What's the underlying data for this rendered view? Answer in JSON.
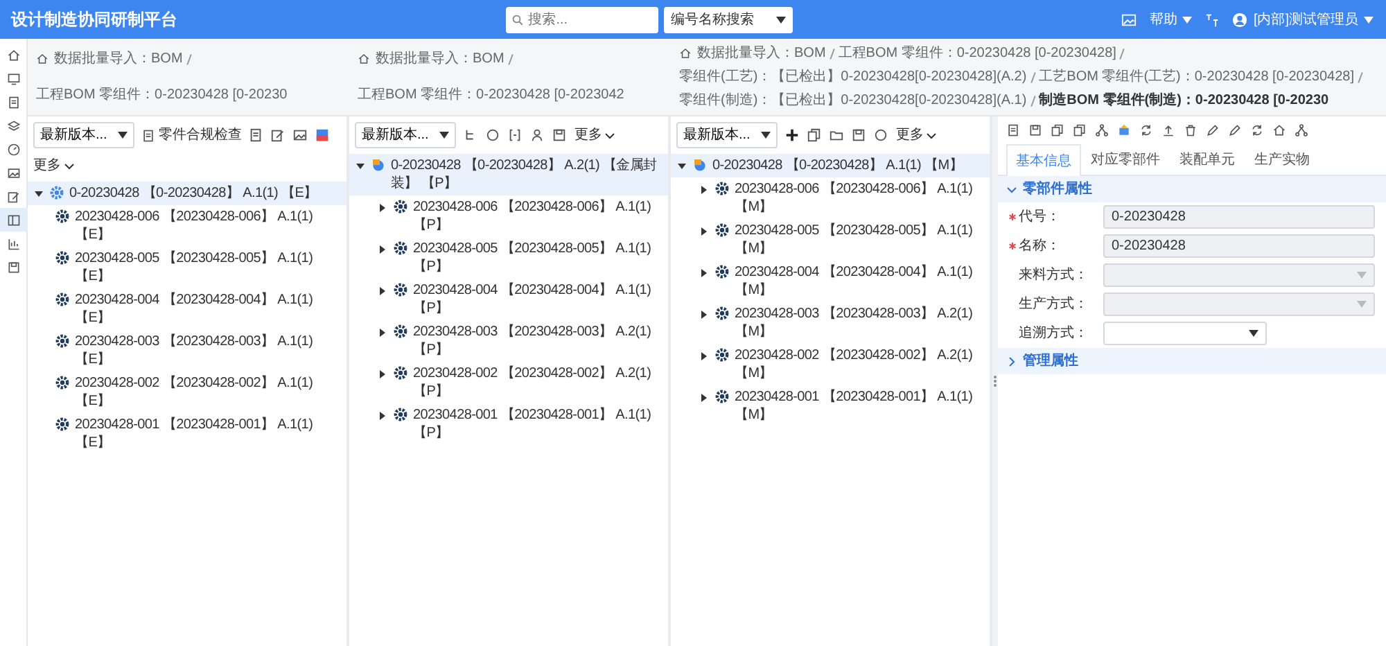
{
  "header": {
    "title": "设计制造协同研制平台",
    "search": {
      "placeholder": "搜索..."
    },
    "search_mode": "编号名称搜索",
    "help": "帮助",
    "user": "[内部]测试管理员"
  },
  "sidebar": {
    "items": [
      {
        "selected": false
      },
      {
        "selected": false
      },
      {
        "selected": false
      },
      {
        "selected": false
      },
      {
        "selected": false
      },
      {
        "selected": false
      },
      {
        "selected": false
      },
      {
        "selected": true
      },
      {
        "selected": false
      },
      {
        "selected": false
      }
    ]
  },
  "panes": [
    {
      "breadcrumb": [
        "数据批量导入：BOM",
        "工程BOM 零组件：0-20230428 [0-20230"
      ],
      "toolbar": {
        "version": "最新版本...",
        "check_button": "零件合规检查",
        "more": "更多"
      },
      "tree": {
        "label": "0-20230428 【0-20230428】 A.1(1) 【E】",
        "selected": true,
        "expanded": true,
        "children": [
          {
            "label": "20230428-006 【20230428-006】 A.1(1) 【E】"
          },
          {
            "label": "20230428-005 【20230428-005】 A.1(1) 【E】"
          },
          {
            "label": "20230428-004 【20230428-004】 A.1(1) 【E】"
          },
          {
            "label": "20230428-003 【20230428-003】 A.1(1) 【E】"
          },
          {
            "label": "20230428-002 【20230428-002】 A.1(1) 【E】"
          },
          {
            "label": "20230428-001 【20230428-001】 A.1(1) 【E】"
          }
        ]
      }
    },
    {
      "breadcrumb": [
        "数据批量导入：BOM",
        "工程BOM 零组件：0-20230428 [0-2023042"
      ],
      "toolbar": {
        "version": "最新版本...",
        "more": "更多"
      },
      "tree": {
        "label": "0-20230428 【0-20230428】 A.2(1) 【金属封装】 【P】",
        "selected": true,
        "expanded": true,
        "children": [
          {
            "label": "20230428-006 【20230428-006】 A.1(1) 【P】",
            "expanded": false
          },
          {
            "label": "20230428-005 【20230428-005】 A.1(1) 【P】",
            "expanded": false
          },
          {
            "label": "20230428-004 【20230428-004】 A.1(1) 【P】",
            "expanded": false
          },
          {
            "label": "20230428-003 【20230428-003】 A.2(1) 【P】",
            "expanded": false
          },
          {
            "label": "20230428-002 【20230428-002】 A.2(1) 【P】",
            "expanded": false
          },
          {
            "label": "20230428-001 【20230428-001】 A.1(1) 【P】",
            "expanded": false
          }
        ]
      }
    },
    {
      "breadcrumb": [
        "数据批量导入：BOM",
        "工程BOM 零组件：0-20230428 [0-20230428]",
        "零组件(工艺)：【已检出】0-20230428[0-20230428](A.2)",
        "工艺BOM 零组件(工艺)：0-20230428 [0-20230428]",
        "零组件(制造)：【已检出】0-20230428[0-20230428](A.1)",
        "制造BOM 零组件(制造)：0-20230428 [0-20230"
      ],
      "toolbar": {
        "version": "最新版本...",
        "more": "更多"
      },
      "tree": {
        "label": "0-20230428 【0-20230428】 A.1(1) 【M】",
        "selected": true,
        "expanded": true,
        "children": [
          {
            "label": "20230428-006 【20230428-006】 A.1(1) 【M】",
            "expanded": false
          },
          {
            "label": "20230428-005 【20230428-005】 A.1(1) 【M】",
            "expanded": false
          },
          {
            "label": "20230428-004 【20230428-004】 A.1(1) 【M】",
            "expanded": false
          },
          {
            "label": "20230428-003 【20230428-003】 A.2(1) 【M】",
            "expanded": false
          },
          {
            "label": "20230428-002 【20230428-002】 A.2(1) 【M】",
            "expanded": false
          },
          {
            "label": "20230428-001 【20230428-001】 A.1(1) 【M】",
            "expanded": false
          }
        ]
      }
    }
  ],
  "detail": {
    "tabs": [
      {
        "label": "基本信息",
        "selected": true
      },
      {
        "label": "对应零部件",
        "selected": false
      },
      {
        "label": "装配单元",
        "selected": false
      },
      {
        "label": "生产实物",
        "selected": false
      }
    ],
    "sections": [
      {
        "title": "零部件属性",
        "expanded": true,
        "fields": [
          {
            "label": "代号：",
            "required": true,
            "kind": "text",
            "value": "0-20230428",
            "disabled": true
          },
          {
            "label": "名称：",
            "required": true,
            "kind": "text",
            "value": "0-20230428",
            "disabled": true
          },
          {
            "label": "来料方式：",
            "required": false,
            "kind": "select",
            "disabled": true
          },
          {
            "label": "生产方式：",
            "required": false,
            "kind": "select",
            "disabled": true
          },
          {
            "label": "追溯方式：",
            "required": false,
            "kind": "select",
            "disabled": false
          }
        ]
      },
      {
        "title": "管理属性",
        "expanded": false
      }
    ]
  }
}
